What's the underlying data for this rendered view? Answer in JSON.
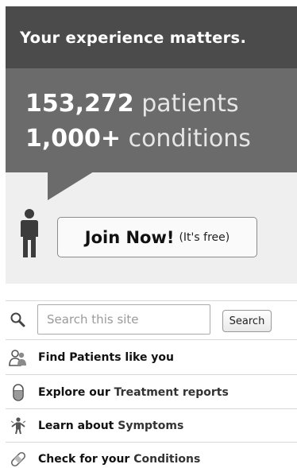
{
  "hero": {
    "tagline": "Your experience matters.",
    "stats": [
      {
        "number": "153,272",
        "label": "patients"
      },
      {
        "number": "1,000+",
        "label": "conditions"
      }
    ]
  },
  "join": {
    "label": "Join Now!",
    "note": "(It's free)"
  },
  "search": {
    "placeholder": "Search this site",
    "value": "",
    "button_label": "Search"
  },
  "menu": {
    "items": [
      {
        "prefix": "Find Patients like you",
        "highlight": "",
        "icon": "people-icon"
      },
      {
        "prefix": "Explore our ",
        "highlight": "Treatment reports",
        "icon": "pill-icon"
      },
      {
        "prefix": "Learn about ",
        "highlight": "Symptoms",
        "icon": "symptom-figure-icon"
      },
      {
        "prefix": "Check for your ",
        "highlight": "Conditions",
        "icon": "bandage-icon"
      }
    ]
  }
}
